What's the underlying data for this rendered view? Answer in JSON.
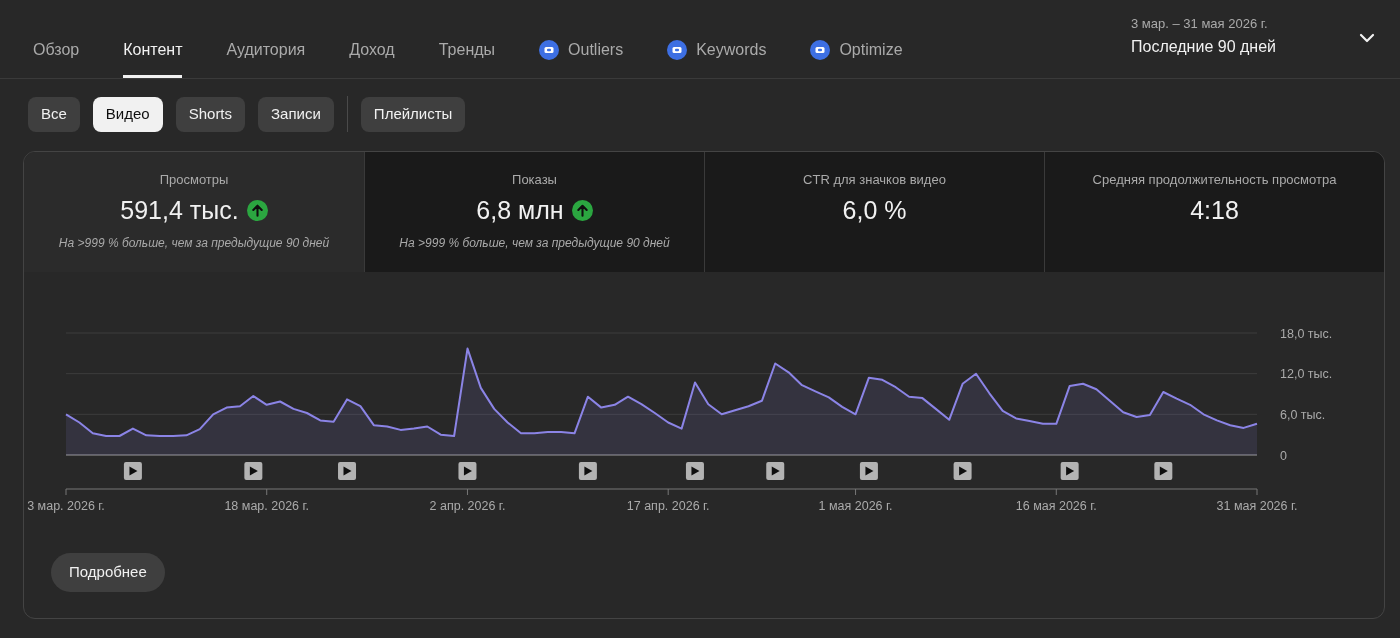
{
  "nav": {
    "tabs": [
      {
        "label": "Обзор",
        "kind": "plain",
        "selected": false
      },
      {
        "label": "Контент",
        "kind": "plain",
        "selected": true
      },
      {
        "label": "Аудитория",
        "kind": "plain",
        "selected": false
      },
      {
        "label": "Доход",
        "kind": "plain",
        "selected": false
      },
      {
        "label": "Тренды",
        "kind": "plain",
        "selected": false
      },
      {
        "label": "Outliers",
        "kind": "iq",
        "selected": false
      },
      {
        "label": "Keywords",
        "kind": "iq",
        "selected": false
      },
      {
        "label": "Optimize",
        "kind": "iq",
        "selected": false
      }
    ]
  },
  "date_range": {
    "range": "3 мар. – 31 мая 2026 г.",
    "period": "Последние 90 дней"
  },
  "filter_groups": [
    {
      "chips": [
        {
          "label": "Все",
          "selected": false
        },
        {
          "label": "Видео",
          "selected": true
        },
        {
          "label": "Shorts",
          "selected": false
        },
        {
          "label": "Записи",
          "selected": false
        }
      ]
    },
    {
      "chips": [
        {
          "label": "Плейлисты",
          "selected": false
        }
      ]
    }
  ],
  "metrics": [
    {
      "label": "Просмотры",
      "value": "591,4 тыс.",
      "trend_up": true,
      "comparison": "На >999 % больше, чем за предыдущие 90 дней",
      "selected": true
    },
    {
      "label": "Показы",
      "value": "6,8 млн",
      "trend_up": true,
      "comparison": "На >999 % больше, чем за предыдущие 90 дней",
      "selected": false
    },
    {
      "label": "CTR для значков видео",
      "value": "6,0 %",
      "trend_up": false,
      "selected": false
    },
    {
      "label": "Средняя продолжительность просмотра",
      "value": "4:18",
      "trend_up": false,
      "selected": false
    }
  ],
  "chart": {
    "chart_data": {
      "type": "area",
      "categories": [
        "3 мар. 2026 г.",
        null,
        null,
        null,
        null,
        null,
        null,
        null,
        null,
        null,
        null,
        null,
        null,
        null,
        null,
        "18 мар. 2026 г.",
        null,
        null,
        null,
        null,
        null,
        null,
        null,
        null,
        null,
        null,
        null,
        null,
        null,
        null,
        "2 апр. 2026 г.",
        null,
        null,
        null,
        null,
        null,
        null,
        null,
        null,
        null,
        null,
        null,
        null,
        null,
        null,
        "17 апр. 2026 г.",
        null,
        null,
        null,
        null,
        null,
        null,
        null,
        null,
        null,
        null,
        null,
        null,
        null,
        "1 мая 2026 г.",
        null,
        null,
        null,
        null,
        null,
        null,
        null,
        null,
        null,
        null,
        null,
        null,
        null,
        null,
        "16 мая 2026 г.",
        null,
        null,
        null,
        null,
        null,
        null,
        null,
        null,
        null,
        null,
        null,
        null,
        null,
        null,
        "31 мая 2026 г."
      ],
      "series": [
        {
          "color": "#8b84e6",
          "values": [
            6.0,
            4.8,
            3.2,
            2.8,
            2.8,
            3.9,
            2.9,
            2.8,
            2.8,
            2.9,
            3.8,
            6.0,
            7.0,
            7.2,
            8.7,
            7.4,
            7.9,
            6.8,
            6.2,
            5.1,
            4.9,
            8.2,
            7.2,
            4.4,
            4.2,
            3.7,
            3.9,
            4.2,
            3.0,
            2.8,
            15.7,
            9.9,
            6.8,
            4.8,
            3.2,
            3.2,
            3.4,
            3.4,
            3.2,
            8.6,
            7.0,
            7.4,
            8.6,
            7.5,
            6.2,
            4.8,
            3.9,
            10.7,
            7.5,
            6.0,
            6.6,
            7.2,
            8.0,
            13.5,
            12.2,
            10.3,
            9.4,
            8.5,
            7.1,
            6.0,
            11.4,
            11.1,
            10.0,
            8.6,
            8.4,
            6.8,
            5.2,
            10.5,
            12.0,
            9.1,
            6.5,
            5.4,
            5.0,
            4.6,
            4.6,
            10.2,
            10.5,
            9.7,
            8.0,
            6.3,
            5.6,
            5.9,
            9.3,
            8.3,
            7.4,
            6.0,
            5.1,
            4.4,
            4.0,
            4.6
          ]
        }
      ],
      "ylim": [
        0,
        18
      ],
      "yticks": [
        0,
        {
          "value": 6,
          "label": "6,0 тыс."
        },
        {
          "value": 12,
          "label": "12,0 тыс."
        },
        {
          "value": 18,
          "label": "18,0 тыс."
        }
      ]
    }
  },
  "more_button": {
    "label": "Подробнее"
  }
}
